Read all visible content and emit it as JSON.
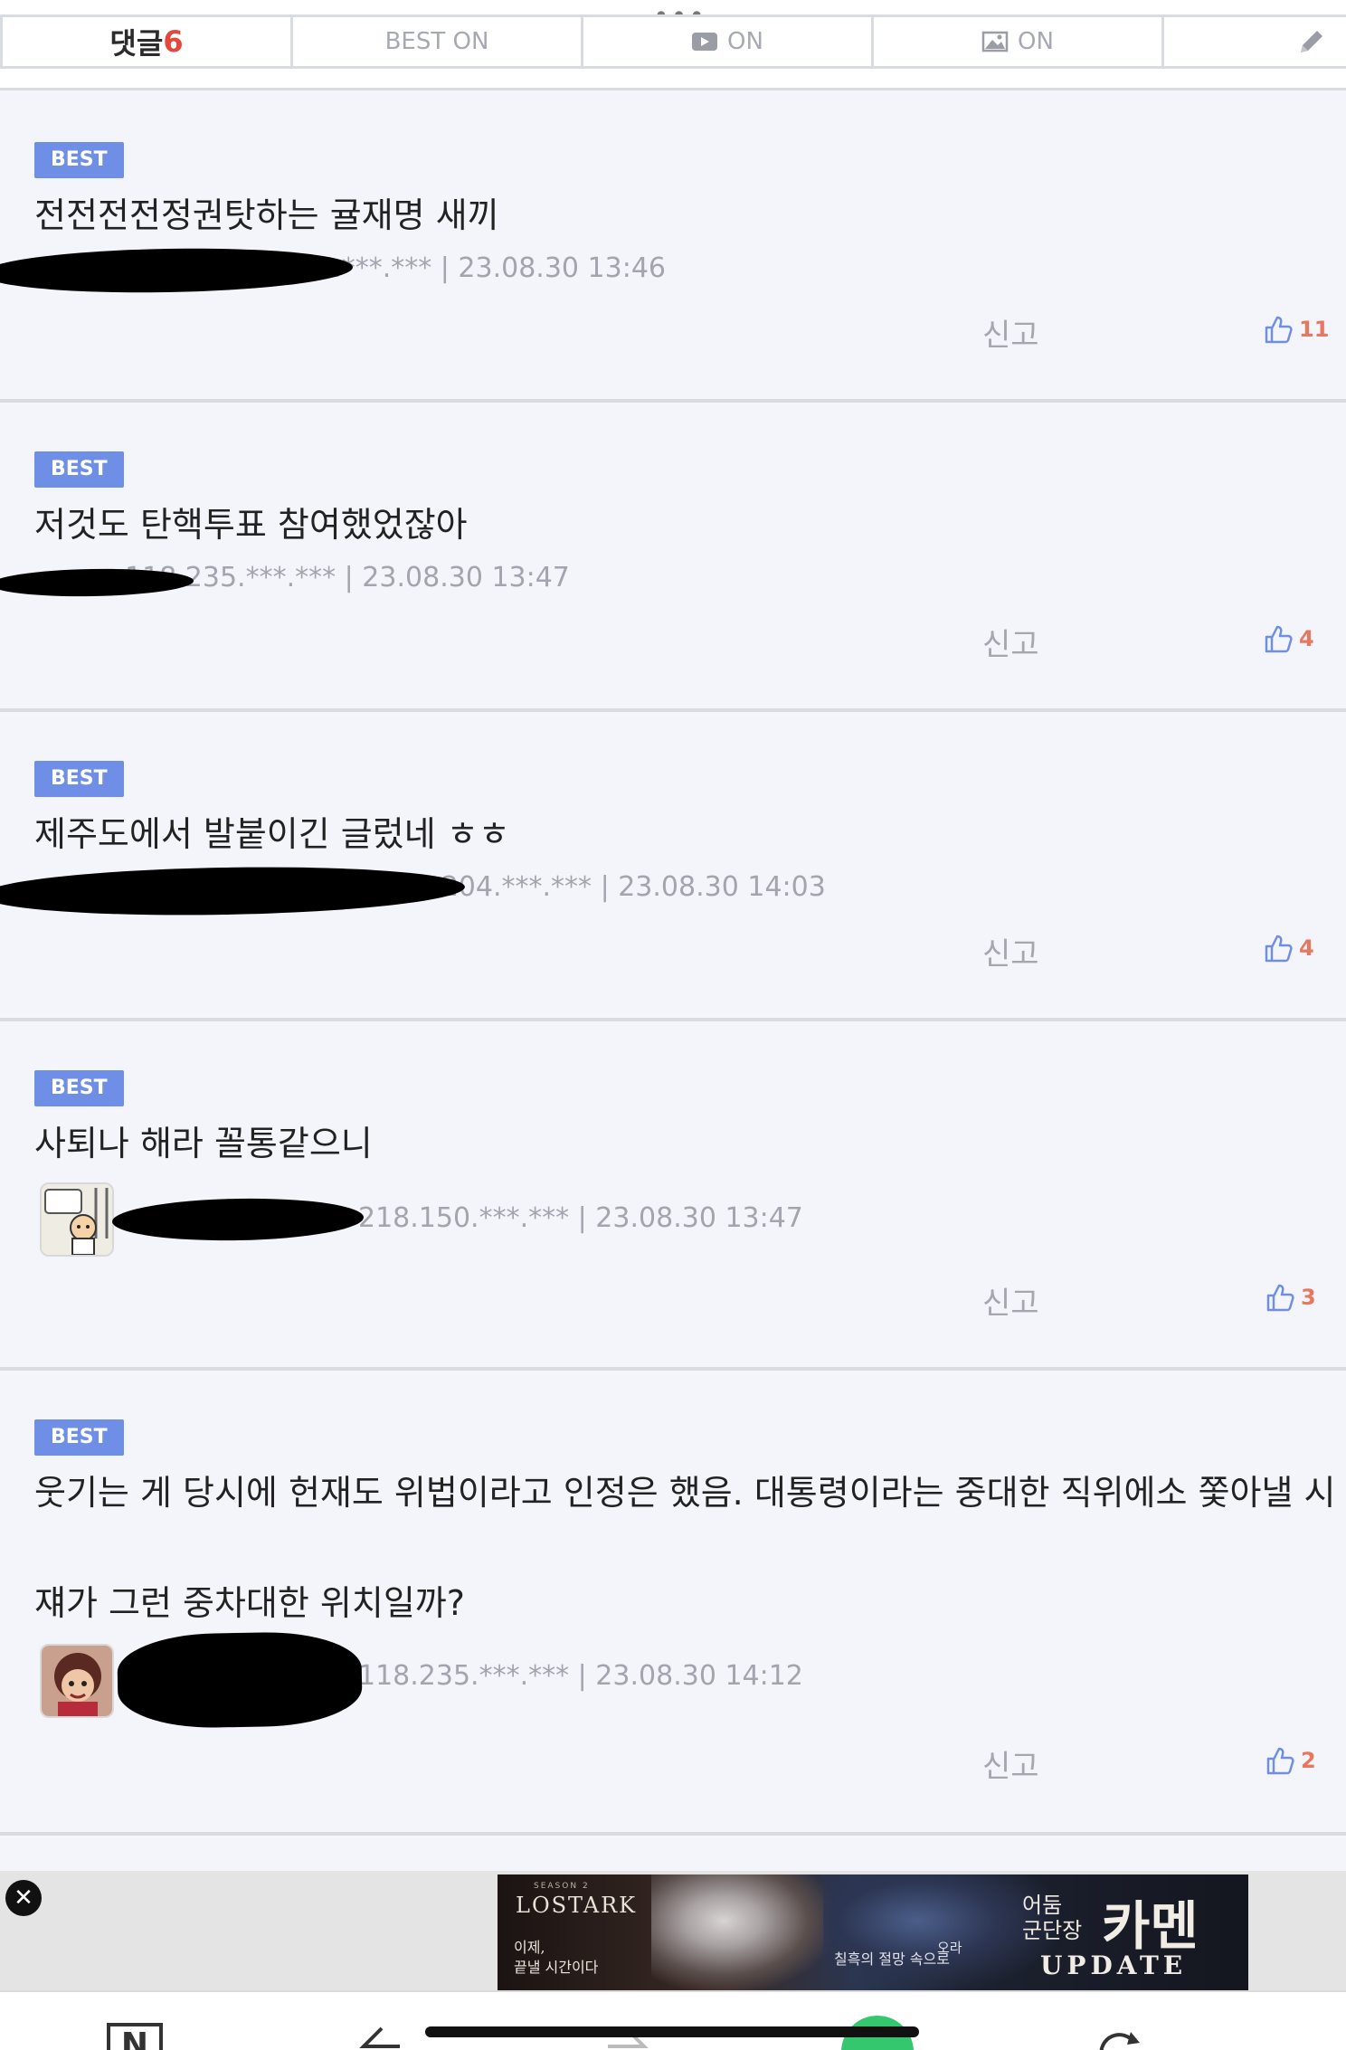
{
  "tabs": {
    "comments_label": "댓글",
    "comments_count": "6",
    "best": "BEST ON",
    "video": "ON",
    "image": "ON",
    "edit_icon": "pencil-icon",
    "more_icon": "ellipsis-icon"
  },
  "comments": [
    {
      "badge": "BEST",
      "body": "전전전전정권탓하는 귤재명 새끼",
      "meta": "25.***.*** | 23.08.30 13:46",
      "report": "신고",
      "likes": "11"
    },
    {
      "badge": "BEST",
      "body": "저것도 탄핵투표 참여했었잖아",
      "meta": "118.235.***.*** | 23.08.30 13:47",
      "report": "신고",
      "likes": "4"
    },
    {
      "badge": "BEST",
      "body": "제주도에서 발붙이긴 글렀네 ㅎㅎ",
      "meta": "75.204.***.*** | 23.08.30 14:03",
      "report": "신고",
      "likes": "4"
    },
    {
      "badge": "BEST",
      "body": "사퇴나 해라 꼴통같으니",
      "meta": "218.150.***.*** | 23.08.30 13:47",
      "report": "신고",
      "likes": "3"
    },
    {
      "badge": "BEST",
      "body": "웃기는 게 당시에 헌재도 위법이라고 인정은 했음. 대통령이라는 중대한 직위에소 쫓아낼 시",
      "body2": "쟤가 그런 중차대한 위치일까?",
      "meta": "118.235.***.*** | 23.08.30 14:12",
      "report": "신고",
      "likes": "2"
    }
  ],
  "ad": {
    "season": "SEASON 2",
    "brand": "LOSTARK",
    "tagline1": "이제,",
    "tagline2": "끝낼 시간이다",
    "mid_top": "오라",
    "mid": "칠흑의 절망 속으로",
    "title_small1": "어둠",
    "title_small2": "군단장",
    "title_big": "카멘",
    "update": "UPDATE",
    "close_icon": "close-icon"
  },
  "colors": {
    "accent": "#6f8fe6",
    "count": "#e5473a",
    "like": "#e77860",
    "background": "#f4f5fa"
  }
}
